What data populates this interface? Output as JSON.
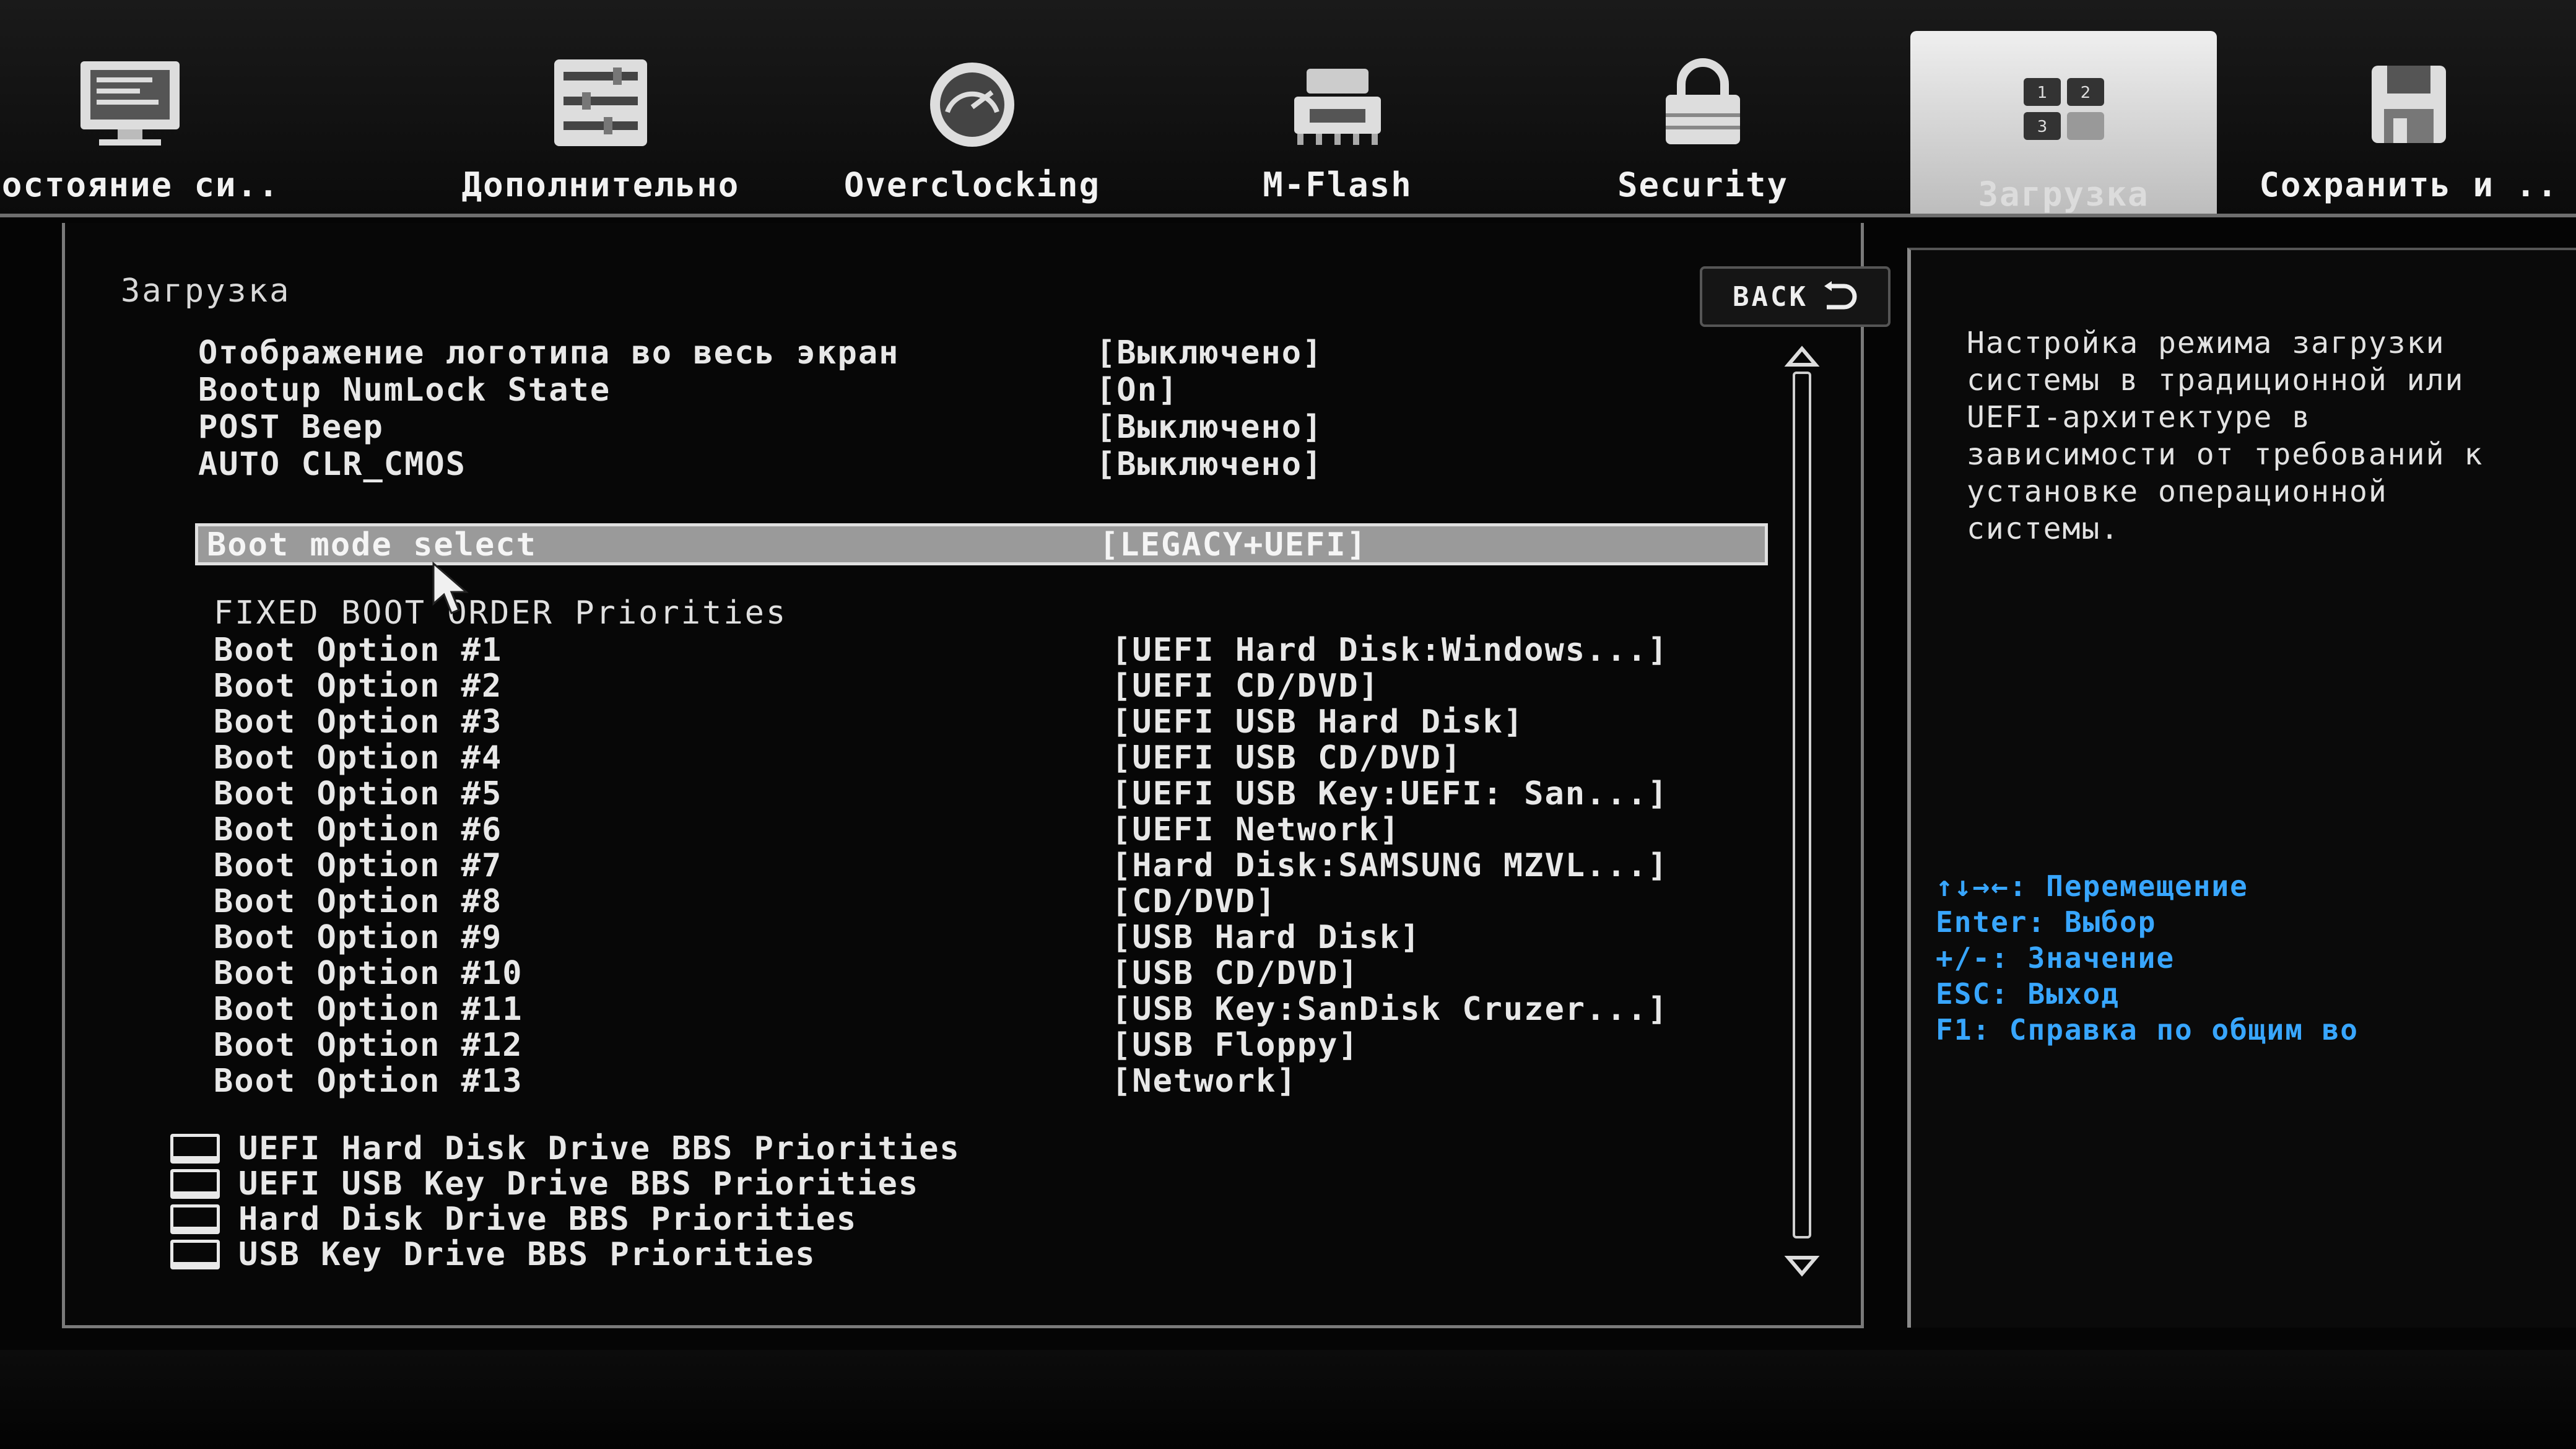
{
  "tabs": [
    {
      "label": "Состояние си..",
      "icon": "monitor-icon"
    },
    {
      "label": "Дополнительно",
      "icon": "sliders-icon"
    },
    {
      "label": "Overclocking",
      "icon": "gauge-icon"
    },
    {
      "label": "M-Flash",
      "icon": "bios-chip-icon"
    },
    {
      "label": "Security",
      "icon": "padlock-icon"
    },
    {
      "label": "Загрузка",
      "icon": "boot-order-icon",
      "active": true
    },
    {
      "label": "Сохранить и ..",
      "icon": "floppy-disk-icon"
    }
  ],
  "section_title": "Загрузка",
  "back_label": "BACK",
  "settings": [
    {
      "name": "Отображение логотипа во весь экран",
      "value": "[Выключено]"
    },
    {
      "name": "Bootup NumLock State",
      "value": "[On]"
    },
    {
      "name": "POST Beep",
      "value": "[Выключено]"
    },
    {
      "name": "AUTO CLR_CMOS",
      "value": "[Выключено]"
    }
  ],
  "boot_mode": {
    "name": "Boot mode select",
    "value": "[LEGACY+UEFI]"
  },
  "fixed_boot_header": "FIXED BOOT ORDER Priorities",
  "boot_options": [
    {
      "name": "Boot Option #1",
      "value": "[UEFI Hard Disk:Windows...]"
    },
    {
      "name": "Boot Option #2",
      "value": "[UEFI CD/DVD]"
    },
    {
      "name": "Boot Option #3",
      "value": "[UEFI USB Hard Disk]"
    },
    {
      "name": "Boot Option #4",
      "value": "[UEFI USB CD/DVD]"
    },
    {
      "name": "Boot Option #5",
      "value": "[UEFI USB Key:UEFI: San...]"
    },
    {
      "name": "Boot Option #6",
      "value": "[UEFI Network]"
    },
    {
      "name": "Boot Option #7",
      "value": "[Hard Disk:SAMSUNG MZVL...]"
    },
    {
      "name": "Boot Option #8",
      "value": "[CD/DVD]"
    },
    {
      "name": "Boot Option #9",
      "value": "[USB Hard Disk]"
    },
    {
      "name": "Boot Option #10",
      "value": "[USB CD/DVD]"
    },
    {
      "name": "Boot Option #11",
      "value": "[USB Key:SanDisk Cruzer...]"
    },
    {
      "name": "Boot Option #12",
      "value": "[USB Floppy]"
    },
    {
      "name": "Boot Option #13",
      "value": "[Network]"
    }
  ],
  "submenus": [
    "UEFI Hard Disk Drive BBS Priorities",
    "UEFI USB Key Drive BBS Priorities",
    "Hard Disk Drive BBS Priorities",
    "USB Key Drive BBS Priorities"
  ],
  "help_text": "Настройка режима загрузки системы в традиционной или UEFI-архитектуре в зависимости от требований к установке операционной системы.",
  "key_hints": [
    "↑↓→←: Перемещение",
    "Enter: Выбор",
    "+/-: Значение",
    "ESC: Выход",
    "F1: Справка по общим во"
  ],
  "colors": {
    "hint": "#38a6ff",
    "highlight": "#9a9a9a"
  }
}
